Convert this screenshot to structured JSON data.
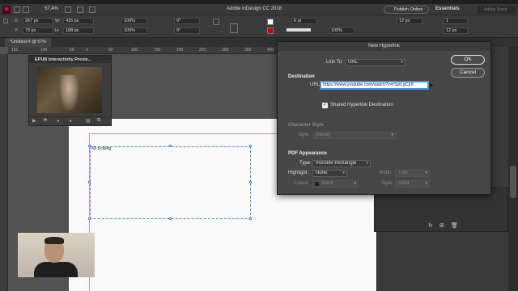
{
  "app": {
    "zoom": "57,4%",
    "title": "Adobe InDesign CC 2018",
    "publish_label": "Publish Online",
    "workspace": "Essentials",
    "search_placeholder": "Adobe Stock",
    "logo": "Id"
  },
  "control": {
    "x_label": "X:",
    "x_value": "267 px",
    "y_label": "Y:",
    "y_value": "73 px",
    "w_label": "W:",
    "w_value": "416 px",
    "h_label": "H:",
    "h_value": "188 px",
    "scale_x": "100%",
    "scale_y": "100%",
    "angle": "0°",
    "shear": "0°",
    "stroke_weight": "6 pt",
    "opacity": "100%",
    "width2": "12 px",
    "columns": "1",
    "gutter": "12 px"
  },
  "document": {
    "tab_label": "*Untitled-4 @ 57%",
    "frame_text": "No Scaling"
  },
  "ruler": {
    "ticks": [
      "150",
      "100",
      "50",
      "0",
      "50",
      "100",
      "150",
      "200",
      "250",
      "300",
      "350",
      "400",
      "450",
      "500",
      "550",
      "600"
    ]
  },
  "epub_panel": {
    "title": "EPUB Interactivity Previe..."
  },
  "dialog": {
    "title": "New Hyperlink",
    "link_to_label": "Link To:",
    "link_to_value": "URL",
    "destination_heading": "Destination",
    "url_label": "URL:",
    "url_value": "https://www.youtube.com/watch?v=rSslt.gCjr9",
    "shared_label": "Shared Hyperlink Destination",
    "char_style_heading": "Character Style",
    "style_label": "Style:",
    "style_value": "[None]",
    "pdf_heading": "PDF Appearance",
    "type_label": "Type:",
    "type_value": "Invisible Rectangle",
    "highlight_label": "Highlight:",
    "highlight_value": "None",
    "width_label": "Width:",
    "width_value": "Thin",
    "colour_label": "Colour:",
    "colour_value": "Black",
    "style2_label": "Style:",
    "style2_value": "Solid",
    "ok_label": "OK",
    "cancel_label": "Cancel"
  }
}
